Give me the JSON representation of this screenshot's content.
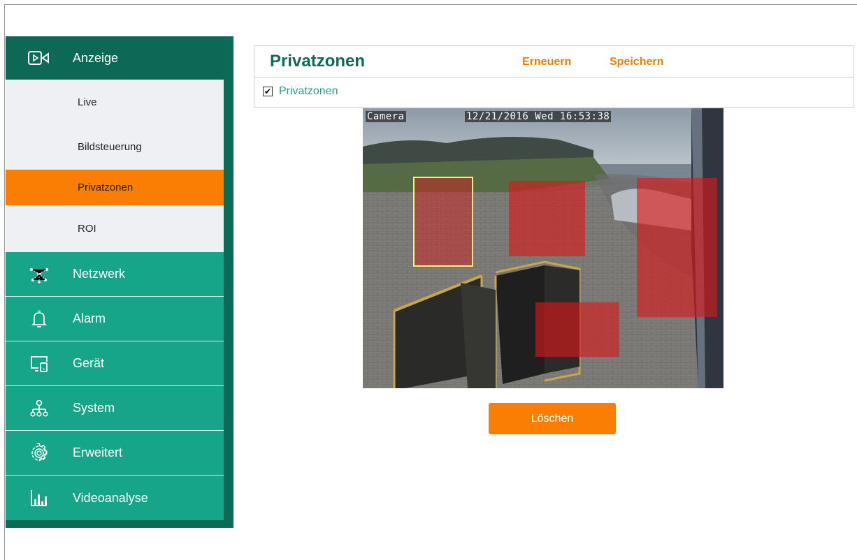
{
  "sidebar": {
    "anzeige": {
      "label": "Anzeige",
      "icon": "video-icon",
      "sub": [
        {
          "label": "Live"
        },
        {
          "label": "Bildsteuerung"
        },
        {
          "label": "Privatzonen"
        },
        {
          "label": "ROI"
        }
      ]
    },
    "items": [
      {
        "label": "Netzwerk",
        "icon": "network-icon"
      },
      {
        "label": "Alarm",
        "icon": "bell-icon"
      },
      {
        "label": "Gerät",
        "icon": "device-icon"
      },
      {
        "label": "System",
        "icon": "hierarchy-icon"
      },
      {
        "label": "Erweitert",
        "icon": "gear-icon"
      },
      {
        "label": "Videoanalyse",
        "icon": "bar-chart-icon"
      }
    ]
  },
  "header": {
    "title": "Privatzonen",
    "refresh_label": "Erneuern",
    "save_label": "Speichern",
    "checkbox_label": "Privatzonen",
    "checkbox_checked": true
  },
  "camera": {
    "name": "Camera",
    "timestamp": "12/21/2016 Wed 16:53:38"
  },
  "delete_label": "Löschen",
  "colors": {
    "primary_dark": "#0b6b57",
    "primary": "#16a589",
    "accent": "#fa7e04",
    "zone_red": "#dc1919",
    "zone_selected_border": "#f5f070"
  }
}
